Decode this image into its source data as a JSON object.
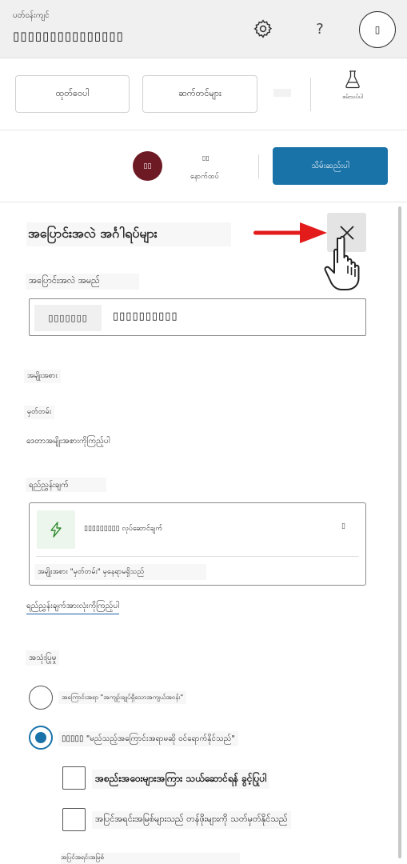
{
  "header": {
    "env_label": "ပတ်ဝန်းကျင်",
    "env_name": "▯▯▯▯▯▯▯▯▯▯▯▯▯▯▯",
    "help_label": "?",
    "avatar_label": "▯"
  },
  "command_bar": {
    "preview_label": "ထုတ်ဝေပါ",
    "settings_label": "ဆက်တင်များ",
    "test_label": "စမ်းသပ်ပါ"
  },
  "status": {
    "badge_label": "▯▯",
    "small_label": "▯▯",
    "status_text": "နောက်ထပ်",
    "publish_label": "သိမ်းဆည်းပါ"
  },
  "panel": {
    "title": "အပြောင်းအလဲ အင်္ဂါရပ်များ",
    "name_label": "အပြောင်းအလဲ အမည်",
    "name_icon_text": "▯▯▯▯▯▯▯",
    "name_value": "▯▯▯▯▯▯▯▯▯▯",
    "type_label": "အမျိုးအစား",
    "category_label": "မှတ်တမ်း",
    "type_value": "ဒေတာအမျိုးအစားကိုကြည့်ပါ",
    "trigger_label": "ရည်ညွှန်းချက်",
    "trigger_name": "▯▯▯▯▯▯▯▯▯ လုပ်ဆောင်ချက်",
    "trigger_more": "▯",
    "trigger_note": "အမျိုးအစား \"မှတ်တမ်း\" မှနေရာမရှိသည်",
    "view_triggers": "ရည်ညွှန်းချက်အားလုံးကိုကြည့်ပါ",
    "usage_label": "အသုံးပြုမှု",
    "radio1_text": "အကြောင်းအရာ \"အကျဉ်းချုပ်ရှိသောအကျယ်အဝန်း\"",
    "radio2_text": "▯▯▯▯▯ \"မည်သည့်အကြောင်းအရာမဆို ဝင်ရောက်နိုင်သည်\"",
    "checkbox1_text": "အစည်းအဝေးများအကြား သယ်ဆောင်ရန် ခွင့်ပြုပါ",
    "checkbox2_text": "အပြင်အရင်းအမြစ်များသည် တန်ဖိုးများကို သတ်မှတ်နိုင်သည်",
    "bottom_partial": "အပြင်အရင်းအမြစ်"
  },
  "colors": {
    "publish": "#1a73a8",
    "badge": "#6e1a24",
    "arrow": "#e31b1b",
    "flash": "#2e8b2e"
  }
}
